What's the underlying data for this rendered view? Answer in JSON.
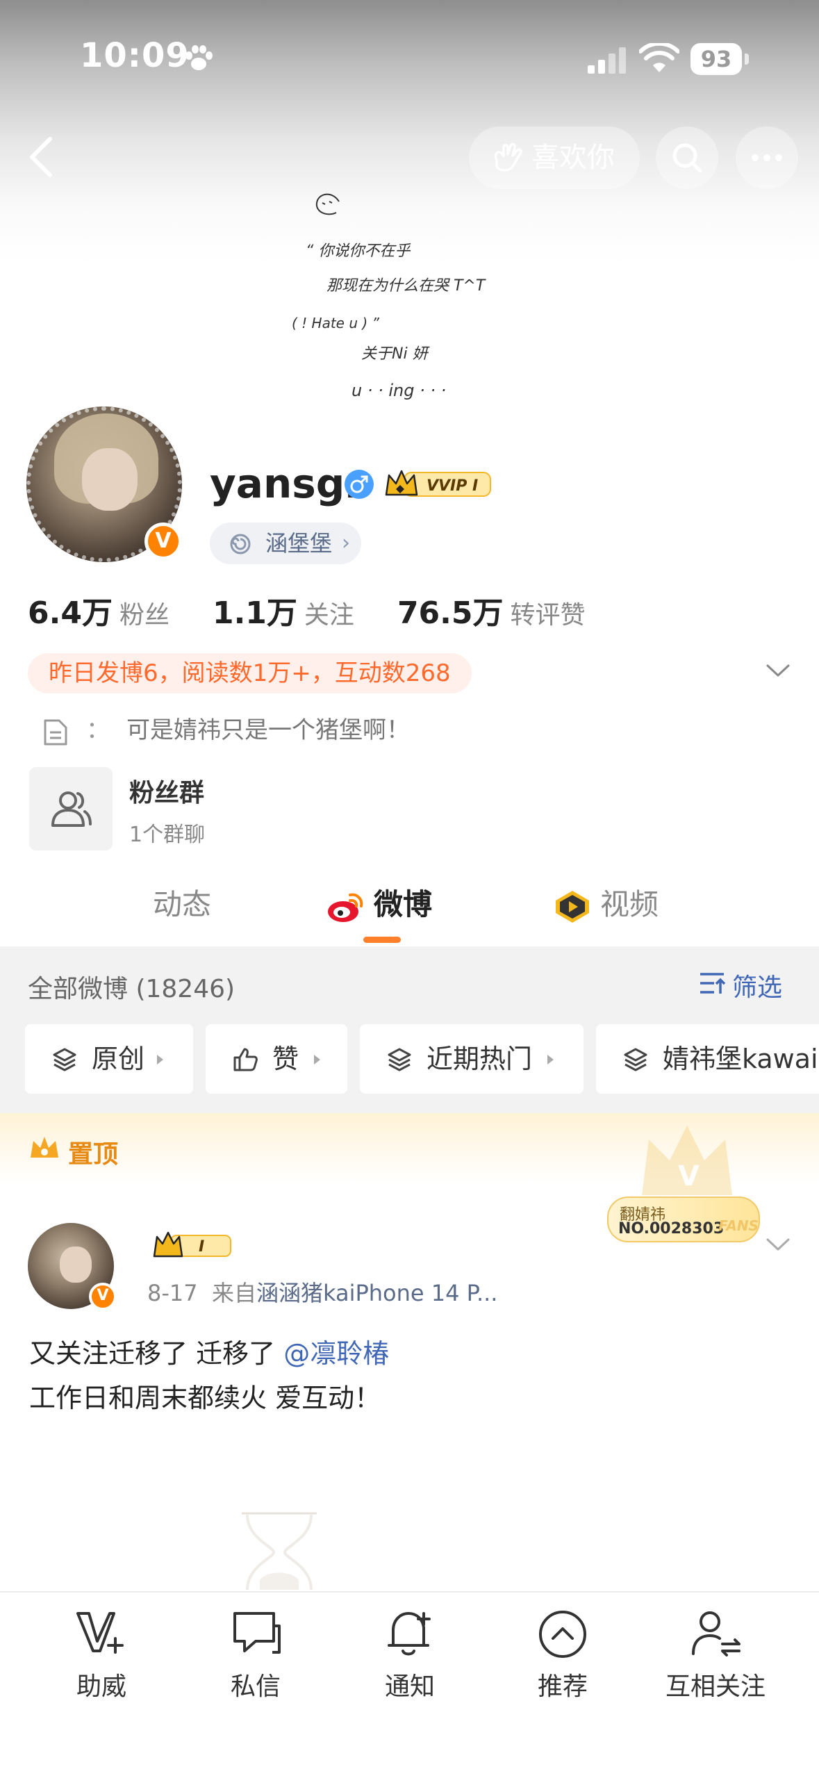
{
  "status_bar": {
    "time": "10:09",
    "battery": "93"
  },
  "header": {
    "like_label": "喜欢你"
  },
  "cover": {
    "doodle_lines": [
      "“ 你说你不在乎",
      "那现在为什么在哭 T^T",
      "( ! Hate u ) ”",
      "关于Ni 妍",
      "u · · ing · · ·"
    ]
  },
  "profile": {
    "username": "yansgr",
    "vip_badge": "VVIP I",
    "affiliation": "涵堡堡",
    "stats": [
      {
        "value": "6.4万",
        "label": "粉丝"
      },
      {
        "value": "1.1万",
        "label": "关注"
      },
      {
        "value": "76.5万",
        "label": "转评赞"
      }
    ],
    "activity": "昨日发博6，阅读数1万+，互动数268",
    "bio_colon": "：",
    "bio": "可是婧祎只是一个猪堡啊！",
    "fan_group": {
      "title": "粉丝群",
      "subtitle": "1个群聊"
    }
  },
  "tabs": [
    {
      "label": "动态"
    },
    {
      "label": "微博"
    },
    {
      "label": "视频"
    }
  ],
  "feed": {
    "count_label": "全部微博 (18246)",
    "filter_label": "筛选",
    "chips": [
      "原创",
      "赞",
      "近期热门",
      "婧祎堡kawai"
    ]
  },
  "pinned": {
    "label": "置顶",
    "fan_card": {
      "line1": "翻婧祎",
      "line2": "NO.0028303",
      "tag": "FANS"
    },
    "badge": "I",
    "date": "8-17",
    "source_prefix": "来自",
    "source": "涵涵猪kaiPhone 14 P...",
    "text_line1": "又关注迁移了 迁移了",
    "mention": "@凛聆椿",
    "text_line2": "工作日和周末都续火 爱互动！"
  },
  "bottom_nav": [
    {
      "label": "助威",
      "icon": "v-plus-icon"
    },
    {
      "label": "私信",
      "icon": "chat-icon"
    },
    {
      "label": "通知",
      "icon": "bell-icon"
    },
    {
      "label": "推荐",
      "icon": "chevron-up-circle-icon"
    },
    {
      "label": "互相关注",
      "icon": "mutual-follow-icon"
    }
  ],
  "colors": {
    "accent": "#ff7f2a",
    "link": "#3f67b5",
    "vip_gold": "#f5b81c",
    "verified": "#ff8200"
  }
}
